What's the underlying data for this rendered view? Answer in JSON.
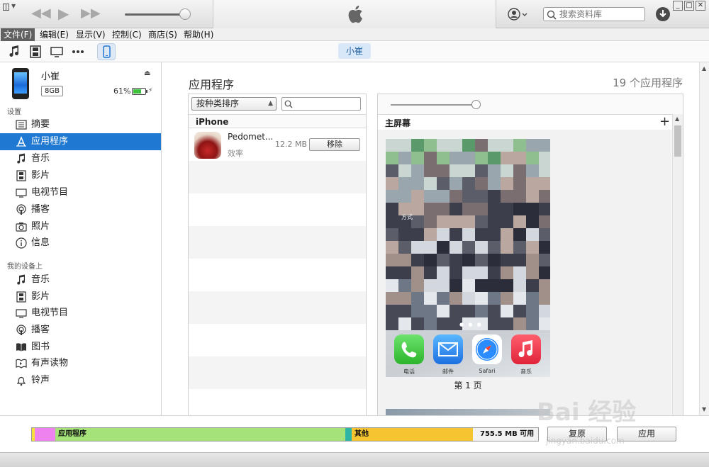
{
  "titlebar": {
    "search_placeholder": "搜索资料库",
    "win_buttons": [
      "_",
      "□",
      "✕"
    ]
  },
  "menu": [
    "文件(F)",
    "编辑(E)",
    "显示(V)",
    "控制(C)",
    "商店(S)",
    "帮助(H)"
  ],
  "mediabar": {
    "device_tab": "小崔"
  },
  "device": {
    "name": "小崔",
    "capacity": "8GB",
    "battery": "61%",
    "battery_level": 0.61
  },
  "sidebar": {
    "settings_header": "设置",
    "settings_items": [
      {
        "label": "摘要",
        "icon": "summary-icon"
      },
      {
        "label": "应用程序",
        "icon": "apps-icon"
      },
      {
        "label": "音乐",
        "icon": "music-note-icon"
      },
      {
        "label": "影片",
        "icon": "film-icon"
      },
      {
        "label": "电视节目",
        "icon": "tv-icon"
      },
      {
        "label": "播客",
        "icon": "podcast-icon"
      },
      {
        "label": "照片",
        "icon": "camera-icon"
      },
      {
        "label": "信息",
        "icon": "info-icon"
      }
    ],
    "ondevice_header": "我的设备上",
    "ondevice_items": [
      {
        "label": "音乐",
        "icon": "music-note-icon"
      },
      {
        "label": "影片",
        "icon": "film-icon"
      },
      {
        "label": "电视节目",
        "icon": "tv-icon"
      },
      {
        "label": "播客",
        "icon": "podcast-icon"
      },
      {
        "label": "图书",
        "icon": "book-icon"
      },
      {
        "label": "有声读物",
        "icon": "audiobook-icon"
      },
      {
        "label": "铃声",
        "icon": "bell-icon"
      }
    ]
  },
  "main": {
    "title": "应用程序",
    "app_count": "19 个应用程序",
    "sort_label": "按种类排序",
    "group": "iPhone",
    "apps": [
      {
        "name": "Pedomet...",
        "category": "效率",
        "size": "12.2 MB",
        "action": "移除"
      }
    ],
    "home_screen_title": "主屏幕",
    "page_label": "第 1 页",
    "dock_apps": [
      {
        "label": "电话",
        "color": "#34c759"
      },
      {
        "label": "邮件",
        "color": "#1e90ff"
      },
      {
        "label": "Safari",
        "color": "#2b8cff"
      },
      {
        "label": "音乐",
        "color": "#fc3c44"
      }
    ],
    "screen_text": "方式"
  },
  "capacity_bar": {
    "segments": [
      {
        "label": "",
        "color": "#f6e13a"
      },
      {
        "label": "",
        "color": "#ee82ee"
      },
      {
        "label": "应用程序",
        "color": "#a6e27a"
      },
      {
        "label": "",
        "color": "#2fb5a5"
      },
      {
        "label": "其他",
        "color": "#f7c431"
      },
      {
        "label": "755.5 MB 可用",
        "color": "#f2f2f2"
      }
    ],
    "restore_label": "复原",
    "apply_label": "应用"
  },
  "watermark": {
    "brand": "Bai 经验",
    "url": "jingyan.baidu.com"
  }
}
